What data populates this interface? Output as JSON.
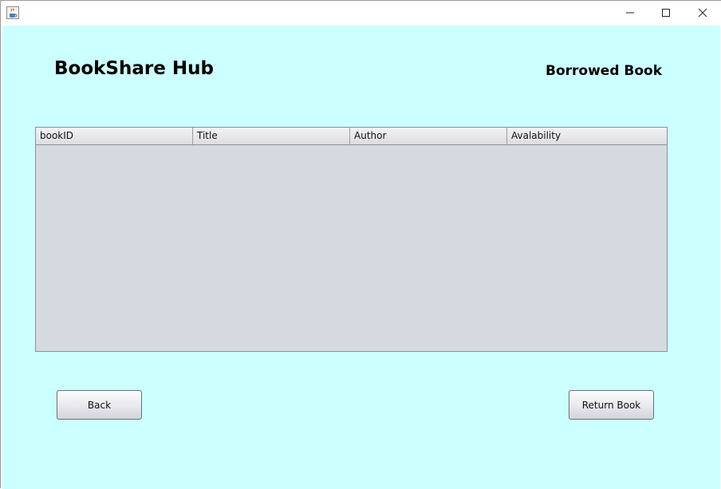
{
  "window": {
    "icons": {
      "app": "java-cup-icon",
      "minimize": "minimize-icon",
      "maximize": "maximize-icon",
      "close": "close-icon"
    }
  },
  "header": {
    "app_title": "BookShare Hub",
    "page_heading": "Borrowed Book"
  },
  "table": {
    "columns": [
      "bookID",
      "Title",
      "Author",
      "Avalability"
    ],
    "rows": []
  },
  "buttons": {
    "back_label": "Back",
    "return_label": "Return Book"
  },
  "colors": {
    "background": "#ccffff",
    "table_body": "#d6d9e0"
  }
}
